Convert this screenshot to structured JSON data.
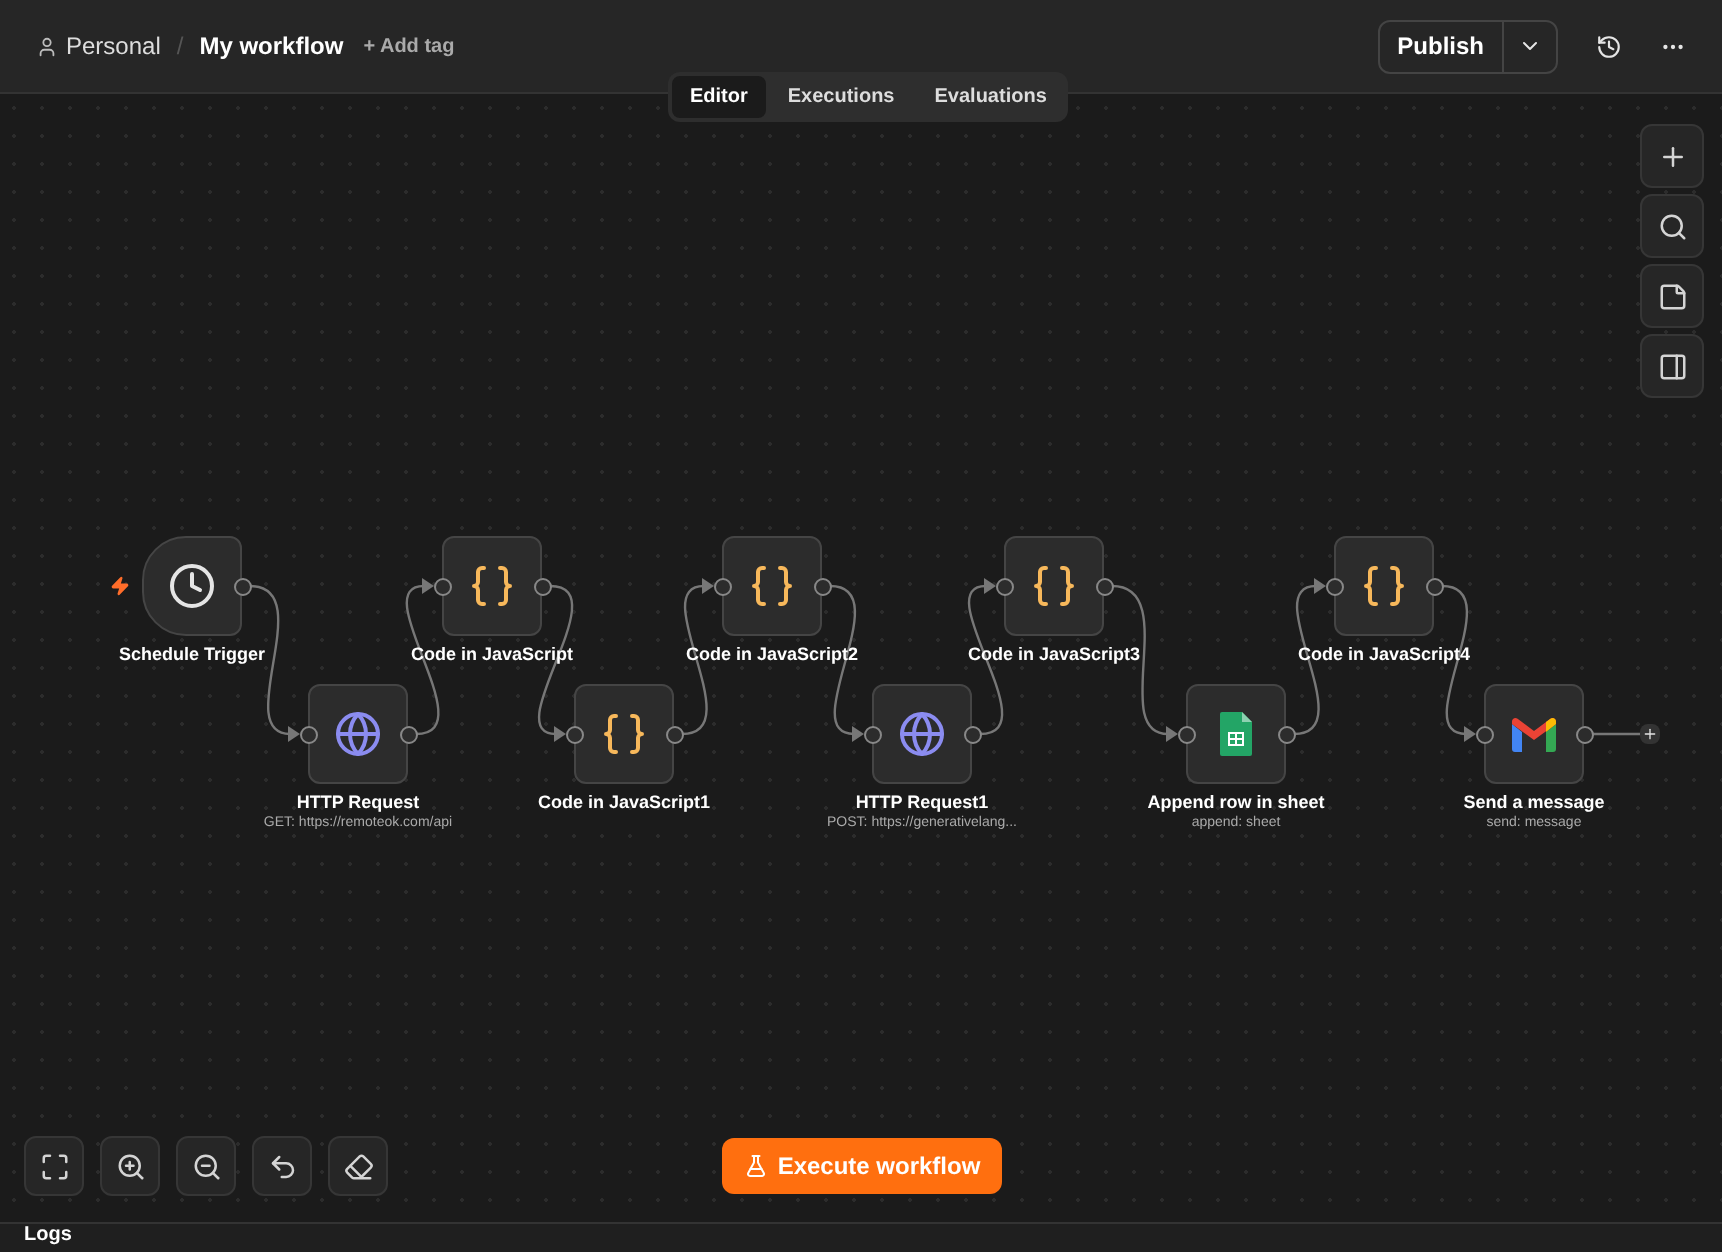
{
  "header": {
    "breadcrumb": "Personal",
    "separator": "/",
    "title": "My workflow",
    "add_tag": "+ Add tag",
    "publish": "Publish"
  },
  "tabs": [
    {
      "label": "Editor",
      "selected": true
    },
    {
      "label": "Executions",
      "selected": false
    },
    {
      "label": "Evaluations",
      "selected": false
    }
  ],
  "nodes": [
    {
      "kind": "trigger",
      "label": "Schedule Trigger"
    },
    {
      "kind": "http",
      "label": "HTTP Request",
      "subtitle": "GET: https://remoteok.com/api"
    },
    {
      "kind": "code",
      "label": "Code in JavaScript"
    },
    {
      "kind": "code",
      "label": "Code in JavaScript1"
    },
    {
      "kind": "code",
      "label": "Code in JavaScript2"
    },
    {
      "kind": "http",
      "label": "HTTP Request1",
      "subtitle": "POST: https://generativelang..."
    },
    {
      "kind": "code",
      "label": "Code in JavaScript3"
    },
    {
      "kind": "sheets",
      "label": "Append row in sheet",
      "subtitle": "append: sheet"
    },
    {
      "kind": "code",
      "label": "Code in JavaScript4"
    },
    {
      "kind": "gmail",
      "label": "Send a message",
      "subtitle": "send: message"
    }
  ],
  "execute_button": "Execute workflow",
  "logs": {
    "title": "Logs"
  }
}
